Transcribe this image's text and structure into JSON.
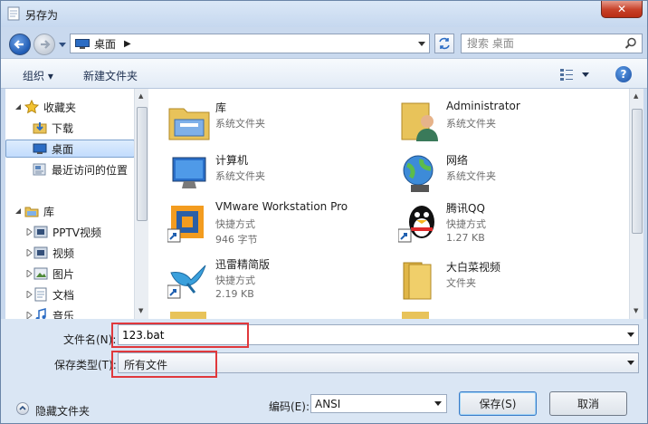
{
  "window": {
    "title": "另存为",
    "close_glyph": "✕"
  },
  "address": {
    "path": "桌面",
    "separator": "▶"
  },
  "search": {
    "placeholder": "搜索 桌面"
  },
  "toolbar": {
    "organize": "组织 ▾",
    "new_folder": "新建文件夹",
    "help": "?"
  },
  "sidebar": {
    "items": [
      {
        "label": "收藏夹",
        "icon": "star-icon"
      },
      {
        "label": "下载",
        "icon": "download-folder-icon"
      },
      {
        "label": "桌面",
        "icon": "desktop-icon",
        "selected": true
      },
      {
        "label": "最近访问的位置",
        "icon": "recent-places-icon"
      },
      {
        "label": "库",
        "icon": "library-icon"
      },
      {
        "label": "PPTV视频",
        "icon": "video-library-icon"
      },
      {
        "label": "视频",
        "icon": "video-library-icon"
      },
      {
        "label": "图片",
        "icon": "pictures-library-icon"
      },
      {
        "label": "文档",
        "icon": "documents-library-icon"
      },
      {
        "label": "音乐",
        "icon": "music-library-icon"
      }
    ]
  },
  "files": [
    {
      "name": "库",
      "type": "系统文件夹",
      "icon": "library-folder-icon"
    },
    {
      "name": "Administrator",
      "type": "系统文件夹",
      "icon": "user-folder-icon"
    },
    {
      "name": "计算机",
      "type": "系统文件夹",
      "icon": "computer-icon"
    },
    {
      "name": "网络",
      "type": "系统文件夹",
      "icon": "network-globe-icon"
    },
    {
      "name": "VMware Workstation Pro",
      "type": "快捷方式",
      "size": "946 字节",
      "icon": "vmware-shortcut-icon"
    },
    {
      "name": "腾讯QQ",
      "type": "快捷方式",
      "size": "1.27 KB",
      "icon": "qq-penguin-icon"
    },
    {
      "name": "迅雷精简版",
      "type": "快捷方式",
      "size": "2.19 KB",
      "icon": "xunlei-bird-icon"
    },
    {
      "name": "大白菜视频",
      "type": "文件夹",
      "icon": "folder-icon"
    }
  ],
  "form": {
    "filename_label": "文件名(N):",
    "filename_value": "123.bat",
    "filetype_label": "保存类型(T):",
    "filetype_value": "所有文件",
    "hide_folders": "隐藏文件夹",
    "encoding_label": "编码(E):",
    "encoding_value": "ANSI",
    "save": "保存(S)",
    "cancel": "取消"
  },
  "colors": {
    "highlight": "#e0383c",
    "selection": "#c2dcfd",
    "window_frame": "#c9d9ee"
  }
}
